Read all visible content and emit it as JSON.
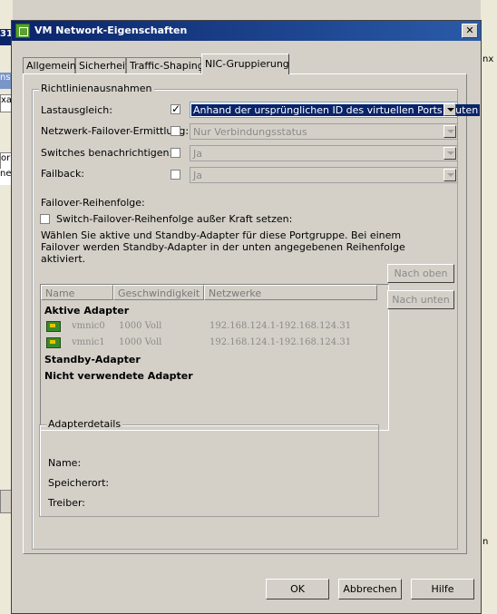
{
  "background": {
    "left_strips": [
      "31",
      "ns",
      "xac",
      "or",
      "ne"
    ],
    "right_strips": [
      "nx",
      "n"
    ]
  },
  "dialog": {
    "title": "VM Network-Eigenschaften",
    "close_glyph": "✕"
  },
  "tabs": [
    {
      "label": "Allgemein"
    },
    {
      "label": "Sicherheit"
    },
    {
      "label": "Traffic-Shaping"
    },
    {
      "label": "NIC-Gruppierung"
    }
  ],
  "policy": {
    "legend": "Richtlinienausnahmen",
    "rows": [
      {
        "label": "Lastausgleich:",
        "checked": true,
        "value": "Anhand der ursprünglichen ID des virtuellen Ports routen",
        "enabled": true
      },
      {
        "label": "Netzwerk-Failover-Ermittlung:",
        "checked": false,
        "value": "Nur Verbindungsstatus",
        "enabled": false
      },
      {
        "label": "Switches benachrichtigen:",
        "checked": false,
        "value": "Ja",
        "enabled": false
      },
      {
        "label": "Failback:",
        "checked": false,
        "value": "Ja",
        "enabled": false
      }
    ],
    "failover_order_label": "Failover-Reihenfolge:",
    "override_label": "Switch-Failover-Reihenfolge außer Kraft setzen:",
    "override_checked": false,
    "description": "Wählen Sie aktive und Standby-Adapter für diese Portgruppe. Bei einem Failover werden Standby-Adapter in der unten angegebenen Reihenfolge aktiviert."
  },
  "adapter_list": {
    "columns": [
      "Name",
      "Geschwindigkeit",
      "Netzwerke"
    ],
    "active_header": "Aktive Adapter",
    "active": [
      {
        "name": "vmnic0",
        "speed": "1000 Voll",
        "network": "192.168.124.1-192.168.124.31"
      },
      {
        "name": "vmnic1",
        "speed": "1000 Voll",
        "network": "192.168.124.1-192.168.124.31"
      }
    ],
    "standby_header": "Standby-Adapter",
    "unused_header": "Nicht verwendete Adapter"
  },
  "move_buttons": {
    "up": "Nach oben",
    "down": "Nach unten"
  },
  "details": {
    "legend": "Adapterdetails",
    "name_label": "Name:",
    "location_label": "Speicherort:",
    "driver_label": "Treiber:"
  },
  "footer": {
    "ok": "OK",
    "cancel": "Abbrechen",
    "help": "Hilfe"
  }
}
